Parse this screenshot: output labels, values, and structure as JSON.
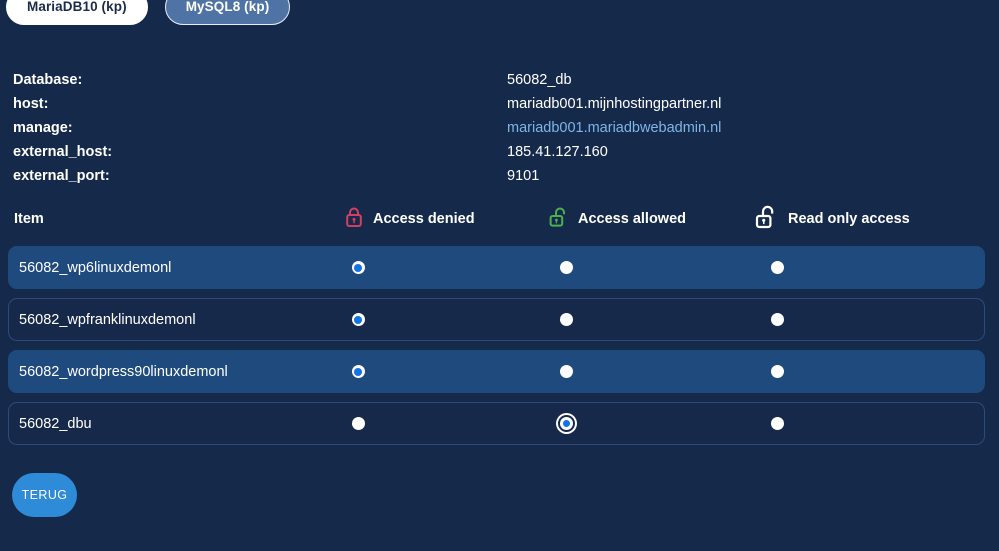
{
  "tabs": [
    {
      "label": "MariaDB10 (kp)",
      "style": "white",
      "name": "tab-mariadb10"
    },
    {
      "label": "MySQL8 (kp)",
      "style": "blue",
      "name": "tab-mysql8"
    }
  ],
  "info": {
    "rows": [
      {
        "label": "Database:",
        "value": "56082_db",
        "link": false
      },
      {
        "label": "host:",
        "value": "mariadb001.mijnhostingpartner.nl",
        "link": false
      },
      {
        "label": "manage:",
        "value": "mariadb001.mariadbwebadmin.nl",
        "link": true
      },
      {
        "label": "external_host:",
        "value": "185.41.127.160",
        "link": false
      },
      {
        "label": "external_port:",
        "value": "9101",
        "link": false
      }
    ]
  },
  "table": {
    "header": {
      "item": "Item",
      "columns": [
        {
          "label": "Access denied",
          "icon": "lock-closed-icon",
          "color": "#d23f63"
        },
        {
          "label": "Access allowed",
          "icon": "lock-open-icon",
          "color": "#4caf50"
        },
        {
          "label": "Read only access",
          "icon": "lock-open-icon",
          "color": "#ffffff"
        }
      ]
    },
    "rows": [
      {
        "label": "56082_wp6linuxdemonl",
        "selected": 0,
        "highlight": true,
        "focused": false
      },
      {
        "label": "56082_wpfranklinuxdemonl",
        "selected": 0,
        "highlight": false,
        "focused": false
      },
      {
        "label": "56082_wordpress90linuxdemonl",
        "selected": 0,
        "highlight": true,
        "focused": false
      },
      {
        "label": "56082_dbu",
        "selected": 1,
        "highlight": false,
        "focused": true
      }
    ]
  },
  "buttons": {
    "back": "TERUG"
  },
  "colors": {
    "background": "#152a4a",
    "row_highlight": "#1e4a7e",
    "row_dark": "#17294a",
    "link": "#7fb4e8",
    "accent": "#2e8bd8",
    "denied": "#d23f63",
    "allowed": "#4caf50"
  }
}
